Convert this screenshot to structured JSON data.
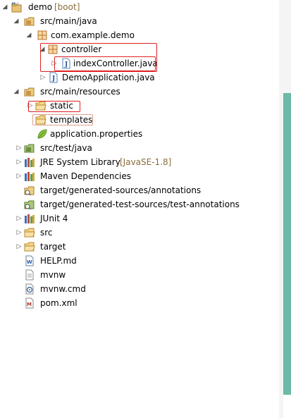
{
  "tree": {
    "rows": [
      {
        "label": "demo",
        "decoration": "[boot]"
      },
      {
        "label": "src/main/java"
      },
      {
        "label": "com.example.demo"
      },
      {
        "label": "controller"
      },
      {
        "label": "indexController.java"
      },
      {
        "label": "DemoApplication.java"
      },
      {
        "label": "src/main/resources"
      },
      {
        "label": "static"
      },
      {
        "label": "templates"
      },
      {
        "label": "application.properties"
      },
      {
        "label": "src/test/java"
      },
      {
        "label": "JRE System Library",
        "decoration": "[JavaSE-1.8]"
      },
      {
        "label": "Maven Dependencies"
      },
      {
        "label": "target/generated-sources/annotations"
      },
      {
        "label": "target/generated-test-sources/test-annotations"
      },
      {
        "label": "JUnit 4"
      },
      {
        "label": "src"
      },
      {
        "label": "target"
      },
      {
        "label": "HELP.md"
      },
      {
        "label": "mvnw"
      },
      {
        "label": "mvnw.cmd"
      },
      {
        "label": "pom.xml"
      }
    ]
  },
  "icons": {
    "project": "maven-boot-project-icon",
    "source_folder": "source-folder-icon",
    "package": "package-icon",
    "java_file": "java-file-icon",
    "folder": "folder-icon",
    "properties": "spring-properties-leaf-icon",
    "library": "library-icon",
    "markdown": "markdown-file-icon",
    "text_file": "text-file-icon",
    "cmd_file": "cmd-file-icon",
    "pom": "maven-pom-icon"
  },
  "colors": {
    "highlight_border": "#e02020",
    "decoration_text": "#8a6d3b",
    "scrollbar": "#6bb9a8"
  }
}
